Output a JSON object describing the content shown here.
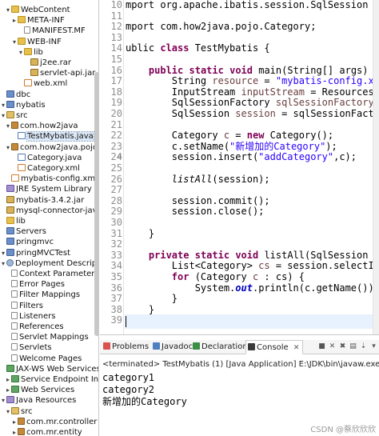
{
  "explorer": {
    "rows": [
      {
        "label": "WebContent",
        "icon": "folder"
      },
      {
        "label": "META-INF",
        "icon": "folder"
      },
      {
        "label": "MANIFEST.MF",
        "icon": "file"
      },
      {
        "label": "WEB-INF",
        "icon": "folder"
      },
      {
        "label": "lib",
        "icon": "folder"
      },
      {
        "label": "j2ee.rar",
        "icon": "jar"
      },
      {
        "label": "servlet-api.jar",
        "icon": "jar"
      },
      {
        "label": "web.xml",
        "icon": "xml"
      },
      {
        "label": "dbc",
        "icon": "project"
      },
      {
        "label": "nybatis",
        "icon": "project"
      },
      {
        "label": "src",
        "icon": "src"
      },
      {
        "label": "com.how2java",
        "icon": "pkg"
      },
      {
        "label": "TestMybatis.java",
        "icon": "java"
      },
      {
        "label": "com.how2java.pojo",
        "icon": "pkg"
      },
      {
        "label": "Category.java",
        "icon": "java"
      },
      {
        "label": "Category.xml",
        "icon": "xml"
      },
      {
        "label": "mybatis-config.xml",
        "icon": "xml"
      },
      {
        "label": "JRE System Library",
        "extra": "[JavaS",
        "icon": "lib"
      },
      {
        "label": "mybatis-3.4.2.jar",
        "icon": "jar"
      },
      {
        "label": "mysql-connector-java-5.0",
        "icon": "jar"
      },
      {
        "label": "lib",
        "icon": "folder"
      },
      {
        "label": "Servers",
        "icon": "project"
      },
      {
        "label": "pringmvc",
        "icon": "project"
      },
      {
        "label": "pringMVCTest",
        "icon": "project"
      },
      {
        "label": "Deployment Descriptor: S",
        "icon": "gear"
      },
      {
        "label": "Context Parameters",
        "icon": "file"
      },
      {
        "label": "Error Pages",
        "icon": "file"
      },
      {
        "label": "Filter Mappings",
        "icon": "file"
      },
      {
        "label": "Filters",
        "icon": "file"
      },
      {
        "label": "Listeners",
        "icon": "file"
      },
      {
        "label": "References",
        "icon": "file"
      },
      {
        "label": "Servlet Mappings",
        "icon": "file"
      },
      {
        "label": "Servlets",
        "icon": "file"
      },
      {
        "label": "Welcome Pages",
        "icon": "file"
      },
      {
        "label": "JAX-WS Web Services",
        "icon": "web"
      },
      {
        "label": "Service Endpoint Interfa",
        "icon": "web"
      },
      {
        "label": "Web Services",
        "icon": "web"
      },
      {
        "label": "Java Resources",
        "icon": "lib"
      },
      {
        "label": "src",
        "icon": "src"
      },
      {
        "label": "com.mr.controller",
        "icon": "pkg"
      },
      {
        "label": "com.mr.entity",
        "icon": "pkg"
      }
    ]
  },
  "editor": {
    "line_numbers": [
      "10",
      "11",
      "12",
      "13",
      "14",
      "15",
      "16",
      "17",
      "18",
      "19",
      "20",
      "21",
      "22",
      "23",
      "24",
      "25",
      "26",
      "27",
      "28",
      "29",
      "30",
      "31",
      "32",
      "33",
      "34",
      "35",
      "36",
      "37",
      "38",
      "39"
    ],
    "fold_markers": {
      "15": "⊖",
      "32": "⊖"
    },
    "lines": [
      "mport org.apache.ibatis.session.SqlSession",
      "",
      "mport com.how2java.pojo.Category;",
      "",
      "ublic class TestMybatis {",
      "",
      "    public static void main(String[] args)",
      "        String resource = \"mybatis-config.x",
      "        InputStream inputStream = Resources",
      "        SqlSessionFactory sqlSessionFactory",
      "        SqlSession session = sqlSessionFact",
      "",
      "        Category c = new Category();",
      "        c.setName(\"新增加的Category\");",
      "        session.insert(\"addCategory\",c);",
      "",
      "        listAll(session);",
      "",
      "        session.commit();",
      "        session.close();",
      "",
      "    }",
      "",
      "    private static void listAll(SqlSession",
      "        List<Category> cs = session.selectI",
      "        for (Category c : cs) {",
      "            System.out.println(c.getName())",
      "        }",
      "    }",
      ""
    ]
  },
  "bottom": {
    "tabs": [
      {
        "label": "Problems"
      },
      {
        "label": "Javadoc"
      },
      {
        "label": "Declaration"
      },
      {
        "label": "Console",
        "suffix": "✕"
      }
    ],
    "console_header": "<terminated> TestMybatis (1) [Java Application] E:\\JDK\\bin\\javaw.exe (2019年5月",
    "output": [
      "category1",
      "category2",
      "新增加的Category"
    ],
    "watermark": "CSDN @蔡欣欣欣"
  }
}
